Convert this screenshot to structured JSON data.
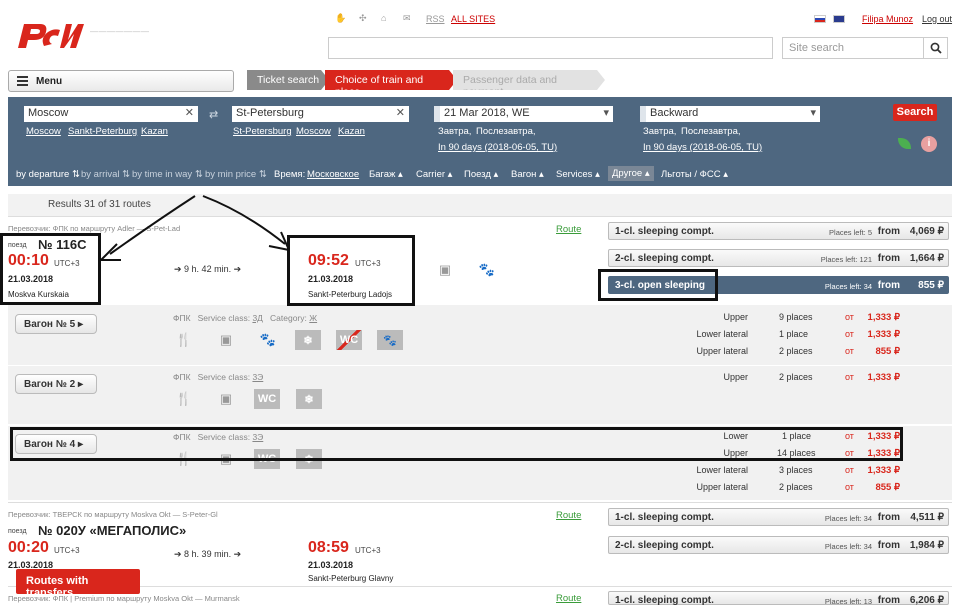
{
  "header": {
    "top_links": [
      "RSS",
      "ALL SITES"
    ],
    "user": "Filipa Munoz",
    "logout": "Log out",
    "site_search_placeholder": "Site search",
    "menu": "Menu",
    "logo_text": "РЖД"
  },
  "steps": [
    "Ticket search",
    "Choice of train and place",
    "Passenger data and payment"
  ],
  "search": {
    "from": "Moscow",
    "from_links": [
      "Moscow",
      "Sankt-Peterburg",
      "Kazan"
    ],
    "to": "St-Petersburg",
    "to_links": [
      "St-Petersburg",
      "Moscow",
      "Kazan"
    ],
    "date": "21 Mar 2018, WE",
    "date_links": [
      "Завтра,",
      "Послезавтра,"
    ],
    "date_in90": "In 90 days (2018-06-05, TU)",
    "back": "Backward",
    "back_links": [
      "Завтра,",
      "Послезавтра,"
    ],
    "back_in90": "In 90 days (2018-06-05, TU)",
    "button": "Search"
  },
  "sort": {
    "by_departure": "by departure",
    "by_arrival": "by arrival",
    "by_time": "by time in way",
    "by_price": "by min price",
    "time_label": "Время:",
    "time_value": "Московское",
    "filters": [
      "Багаж",
      "Carrier",
      "Поезд",
      "Вагон",
      "Services",
      "Другое",
      "Льготы / ФСС"
    ]
  },
  "results": "Results 31 of 31 routes",
  "train1": {
    "carrier": "Перевозчик: ФПК  по маршруту Adler — S-Pet-Lad",
    "route": "Route",
    "label": "поезд",
    "number": "№ 116С",
    "dep_time": "00:10",
    "utc": "UTC+3",
    "dep_date": "21.03.2018",
    "dep_station": "Moskva Kurskaia",
    "duration": "9 h. 42 min.",
    "arr_time": "09:52",
    "arr_date": "21.03.2018",
    "arr_station": "Sankt-Peterburg Ladojs",
    "classes": [
      {
        "name": "1-cl. sleeping compt.",
        "places": "Places left: 5",
        "from": "from",
        "price": "4,069 ₽"
      },
      {
        "name": "2-cl. sleeping compt.",
        "places": "Places left: 121",
        "from": "from",
        "price": "1,664 ₽"
      },
      {
        "name": "3-cl. open sleeping",
        "places": "Places left: 34",
        "from": "from",
        "price": "855 ₽"
      }
    ]
  },
  "wagons": [
    {
      "name": "Вагон № 5",
      "carrier": "ФПК",
      "service": "Service class:",
      "service_val": "3Д",
      "category": "Category:",
      "category_val": "Ж",
      "rows": [
        {
          "seat": "Upper",
          "count": "9 places",
          "ot": "от",
          "price": "1,333 ₽"
        },
        {
          "seat": "Lower lateral",
          "count": "1 place",
          "ot": "от",
          "price": "1,333 ₽"
        },
        {
          "seat": "Upper lateral",
          "count": "2 places",
          "ot": "от",
          "price": "855 ₽"
        }
      ]
    },
    {
      "name": "Вагон № 2",
      "carrier": "ФПК",
      "service": "Service class:",
      "service_val": "3Э",
      "rows": [
        {
          "seat": "Upper",
          "count": "2 places",
          "ot": "от",
          "price": "1,333 ₽"
        }
      ]
    },
    {
      "name": "Вагон № 4",
      "carrier": "ФПК",
      "service": "Service class:",
      "service_val": "3Э",
      "rows": [
        {
          "seat": "Lower",
          "count": "1 place",
          "ot": "от",
          "price": "1,333 ₽"
        },
        {
          "seat": "Upper",
          "count": "14 places",
          "ot": "от",
          "price": "1,333 ₽"
        },
        {
          "seat": "Lower lateral",
          "count": "3 places",
          "ot": "от",
          "price": "1,333 ₽"
        },
        {
          "seat": "Upper lateral",
          "count": "2 places",
          "ot": "от",
          "price": "855 ₽"
        }
      ]
    }
  ],
  "train2": {
    "carrier": "Перевозчик: ТВЕРСК  по маршруту Moskva Okt — S-Peter-Gl",
    "route": "Route",
    "label": "поезд",
    "number": "№ 020У «МЕГАПОЛИС»",
    "dep_time": "00:20",
    "utc": "UTC+3",
    "dep_date": "21.03.2018",
    "duration": "8 h. 39 min.",
    "arr_time": "08:59",
    "arr_date": "21.03.2018",
    "arr_station": "Sankt-Peterburg Glavny",
    "classes": [
      {
        "name": "1-cl. sleeping compt.",
        "places": "Places left: 34",
        "from": "from",
        "price": "4,511 ₽"
      },
      {
        "name": "2-cl. sleeping compt.",
        "places": "Places left: 34",
        "from": "from",
        "price": "1,984 ₽"
      }
    ]
  },
  "train3": {
    "carrier": "Перевозчик: ФПК | Premium  по маршруту Moskva Okt — Murmansk",
    "route": "Route",
    "class": {
      "name": "1-cl. sleeping compt.",
      "places": "Places left: 13",
      "from": "from",
      "price": "6,206 ₽"
    }
  },
  "transfers": "Routes with transfers",
  "colors": {
    "brand_red": "#d9261c",
    "panel": "#4e6780",
    "route_green": "#3a9c3a"
  }
}
